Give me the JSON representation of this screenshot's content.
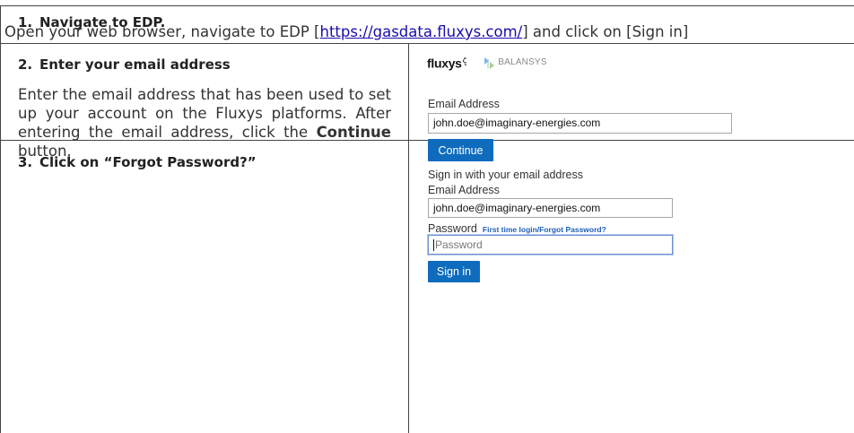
{
  "step1": {
    "number": "1.",
    "heading": "Navigate to EDP.",
    "text_before": "Open your web browser, navigate to EDP [",
    "link": "https://gasdata.fluxys.com/",
    "text_after": "] and click on [Sign in]"
  },
  "step2": {
    "number": "2.",
    "heading": "Enter your email address",
    "body_before": "Enter the email address that has been used to set up your account on the Fluxys platforms. After entering the email address, click the ",
    "body_bold": "Continue",
    "body_after": " button."
  },
  "step3": {
    "number": "3.",
    "heading": "Click on “Forgot Password?”"
  },
  "login1": {
    "brand": "fluxys",
    "brand_mark": "෫",
    "partner": "BALANSYS",
    "email_label": "Email Address",
    "email_value": "john.doe@imaginary-energies.com",
    "continue_label": "Continue"
  },
  "login2": {
    "header": "Sign in with your email address",
    "email_label": "Email Address",
    "email_value": "john.doe@imaginary-energies.com",
    "password_label": "Password",
    "forgot_link": "First time login/Forgot Password?",
    "password_placeholder": "Password",
    "signin_label": "Sign in"
  },
  "colors": {
    "button": "#0f6cbd",
    "link": "#1a0dab",
    "grid": "#444444"
  }
}
